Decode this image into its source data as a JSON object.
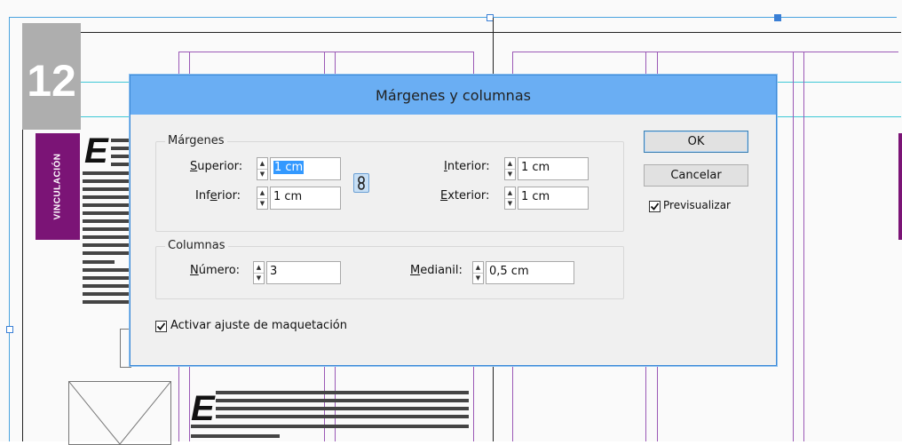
{
  "background": {
    "page_number": "12",
    "section_tab": "VINCULACIÓN",
    "dropcap_letter": "E"
  },
  "dialog": {
    "title": "Márgenes y columnas",
    "margins": {
      "legend": "Márgenes",
      "top": {
        "label_pre": "",
        "label_ul": "S",
        "label_post": "uperior:",
        "value": "1 cm",
        "selected": true
      },
      "bottom": {
        "label_pre": "Inf",
        "label_ul": "e",
        "label_post": "rior:",
        "value": "1 cm"
      },
      "inside": {
        "label_pre": "",
        "label_ul": "I",
        "label_post": "nterior:",
        "value": "1 cm"
      },
      "outside": {
        "label_pre": "",
        "label_ul": "E",
        "label_post": "xterior:",
        "value": "1 cm"
      }
    },
    "columns": {
      "legend": "Columnas",
      "number": {
        "label_pre": "",
        "label_ul": "N",
        "label_post": "úmero:",
        "value": "3"
      },
      "gutter": {
        "label_pre": "",
        "label_ul": "M",
        "label_post": "edianil:",
        "value": "0,5 cm"
      }
    },
    "layout_adjust": {
      "label": "Activar ajuste de maquetación",
      "checked": true
    },
    "buttons": {
      "ok": "OK",
      "cancel": "Cancelar"
    },
    "preview": {
      "label": "Previsualizar",
      "checked": true
    }
  },
  "colors": {
    "titlebar": "#6aaef3",
    "magenta_tab": "#7b1476",
    "margin_guides": "#9b59b6",
    "column_guides": "#3fc8d6"
  }
}
